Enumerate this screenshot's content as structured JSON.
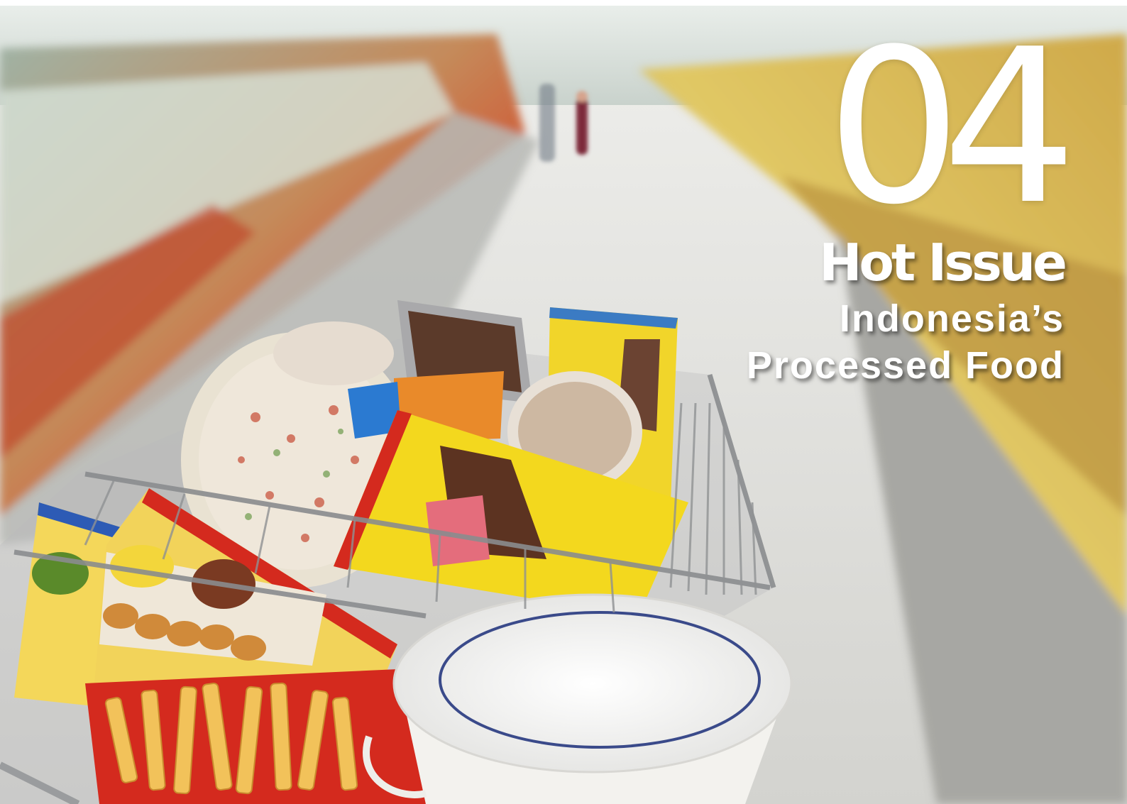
{
  "cover": {
    "chapter_number": "04",
    "section_label": "Hot Issue",
    "headline_line1": "Indonesia’s",
    "headline_line2": "Processed Food"
  },
  "photo": {
    "subject": "shopping-cart-in-supermarket-aisle",
    "colors": {
      "floor": "#dcdcd8",
      "shelf_left": "#b8c4b0",
      "shelf_right": "#d9c37a",
      "cart_wire": "#8a8c8e",
      "accent_red": "#d42a1e",
      "accent_yellow": "#f3d81e"
    }
  }
}
